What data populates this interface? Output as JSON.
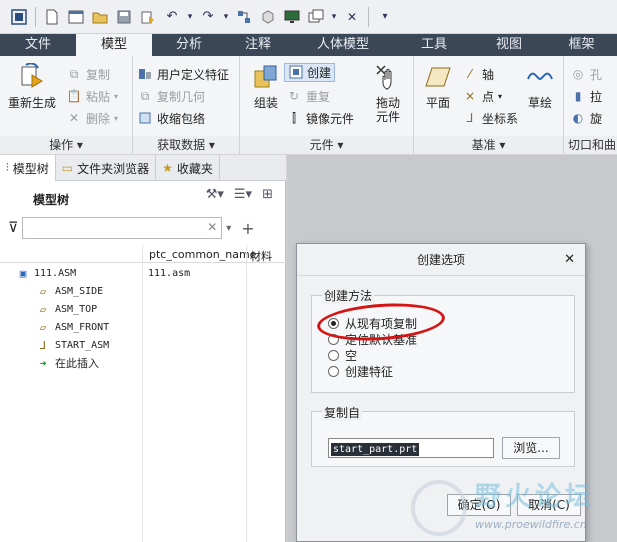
{
  "quick_access": [
    "app-icon",
    "new-icon",
    "window-icon",
    "open-icon",
    "save-icon",
    "regen-icon",
    "undo-icon",
    "redo-icon",
    "model-icon",
    "cube-icon",
    "monitor-icon",
    "windows-icon",
    "close-icon",
    "dropdown-icon"
  ],
  "tabs": [
    "文件",
    "模型",
    "分析",
    "注释",
    "人体模型",
    "工具",
    "视图",
    "框架"
  ],
  "ribbon": {
    "operations": {
      "regen": "重新生成",
      "copy": "复制",
      "paste": "粘贴",
      "delete": "删除",
      "label": "操作"
    },
    "get_data": {
      "udf": "用户定义特征",
      "copy_geom": "复制几何",
      "shrinkwrap": "收缩包络",
      "label": "获取数据"
    },
    "component": {
      "assemble": "组装",
      "create": "创建",
      "repeat": "重复",
      "mirror": "镜像元件",
      "drag": "拖动\n元件",
      "label": "元件"
    },
    "datum": {
      "plane": "平面",
      "axis": "轴",
      "point": "点",
      "csys": "坐标系",
      "sketch": "草绘",
      "label": "基准"
    },
    "cut_surface": {
      "hole": "孔",
      "extrude": "拉",
      "revolve": "旋",
      "label": "切口和曲"
    }
  },
  "panel": {
    "tabs": [
      "模型树",
      "文件夹浏览器",
      "收藏夹"
    ],
    "tree_title": "模型树",
    "filter_placeholder": "",
    "columns": [
      "ptc_common_name",
      "材料"
    ],
    "items": [
      {
        "label": "111.ASM",
        "common_name": "111.asm",
        "icon": "assembly-icon"
      },
      {
        "label": "ASM_SIDE",
        "common_name": "",
        "icon": "datum-plane-icon"
      },
      {
        "label": "ASM_TOP",
        "common_name": "",
        "icon": "datum-plane-icon"
      },
      {
        "label": "ASM_FRONT",
        "common_name": "",
        "icon": "datum-plane-icon"
      },
      {
        "label": "START_ASM",
        "common_name": "",
        "icon": "csys-icon"
      },
      {
        "label": "在此插入",
        "common_name": "",
        "icon": "insert-arrow-icon"
      }
    ]
  },
  "dialog": {
    "title": "创建选项",
    "method_label": "创建方法",
    "options": [
      "从现有项复制",
      "定位默认基准",
      "空",
      "创建特征"
    ],
    "selected_option": "从现有项复制",
    "copy_from_label": "复制自",
    "copy_from_value": "start_part.prt",
    "browse": "浏览...",
    "ok": "确定(O)",
    "cancel": "取消(C)"
  },
  "watermark": {
    "title": "野火论坛",
    "url": "www.proewildfire.cn"
  },
  "colors": {
    "tab_bar": "#3b4656",
    "annotation": "#d41414",
    "ribbon": "#f4f5f7"
  }
}
